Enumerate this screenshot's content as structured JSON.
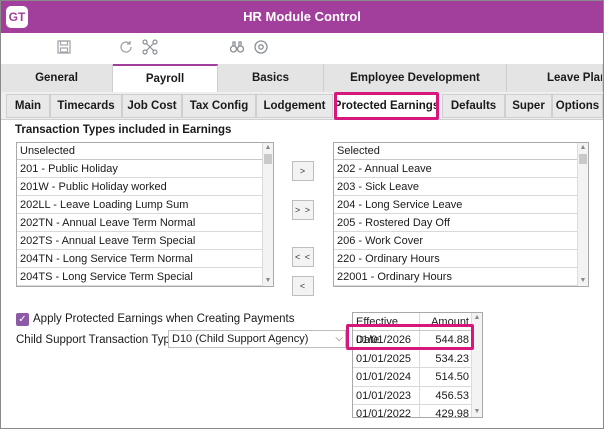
{
  "window": {
    "logo": "GT",
    "title": "HR Module Control"
  },
  "toolbar": {
    "icons": [
      "save-icon",
      "refresh-icon",
      "hierarchy-icon",
      "binoculars-icon",
      "settings-icon"
    ]
  },
  "main_tabs": [
    "General",
    "Payroll",
    "Basics",
    "Employee Development",
    "Leave Plann"
  ],
  "main_tabs_active": "Payroll",
  "sub_tabs": [
    "Main",
    "Timecards",
    "Job Cost",
    "Tax Config",
    "Lodgement",
    "Protected Earnings",
    "Defaults",
    "Super",
    "Options"
  ],
  "sub_tabs_active": "Protected Earnings",
  "section_title": "Transaction Types included in Earnings",
  "unselected": {
    "header": "Unselected",
    "items": [
      "201 - Public Holiday",
      "201W - Public Holiday worked",
      "202LL - Leave Loading Lump Sum",
      "202TN - Annual Leave Term Normal",
      "202TS - Annual Leave Term Special",
      "204TN - Long Service Term Normal",
      "204TS - Long Service Term Special"
    ]
  },
  "selected": {
    "header": "Selected",
    "items": [
      "202 - Annual Leave",
      "203 - Sick Leave",
      "204 - Long Service Leave",
      "205 - Rostered Day Off",
      "206 - Work Cover",
      "220 - Ordinary Hours",
      "22001 - Ordinary Hours"
    ]
  },
  "transfer_buttons": {
    "add_one": ">",
    "add_all": "> >",
    "remove_all": "< <",
    "remove_one": "<"
  },
  "apply_checkbox": {
    "label": "Apply Protected Earnings when Creating Payments",
    "checked": true
  },
  "child_support": {
    "label": "Child Support Transaction Type",
    "value": "D10 (Child Support Agency)"
  },
  "effective_table": {
    "headers": [
      "Effective Date",
      "Amount"
    ],
    "rows": [
      {
        "date": "01/01/2026",
        "amount": "544.88"
      },
      {
        "date": "01/01/2025",
        "amount": "534.23"
      },
      {
        "date": "01/01/2024",
        "amount": "514.50"
      },
      {
        "date": "01/01/2023",
        "amount": "456.53"
      },
      {
        "date": "01/01/2022",
        "amount": "429.98"
      }
    ]
  },
  "colors": {
    "brand": "#a23f9c",
    "highlight": "#d6177b",
    "checkbox": "#8d5aa8"
  }
}
